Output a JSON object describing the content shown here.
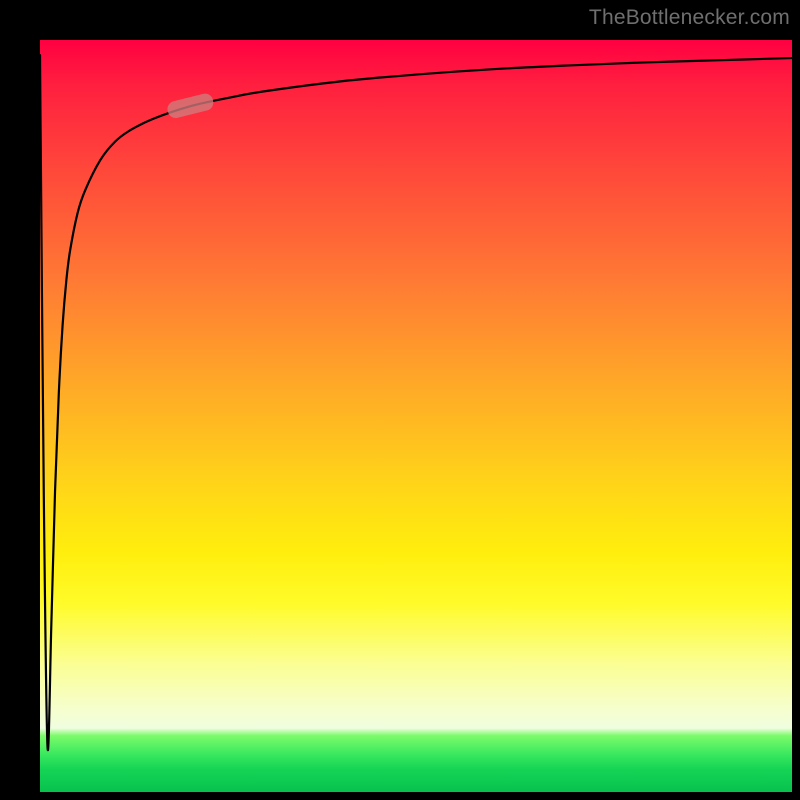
{
  "watermark": "TheBottlenecker.com",
  "chart_data": {
    "type": "line",
    "title": "",
    "xlabel": "",
    "ylabel": "",
    "xlim": [
      0,
      100
    ],
    "ylim": [
      0,
      100
    ],
    "x": [
      0,
      0.5,
      1,
      1.5,
      2,
      2.5,
      3,
      3.5,
      4,
      5,
      6,
      8,
      10,
      12,
      15,
      20,
      25,
      30,
      40,
      50,
      60,
      70,
      80,
      90,
      100
    ],
    "values": [
      98,
      40,
      6,
      22,
      40,
      53,
      62,
      68,
      72,
      77,
      80,
      84,
      86.5,
      88,
      89.5,
      91.2,
      92.3,
      93.2,
      94.5,
      95.4,
      96.1,
      96.6,
      97.0,
      97.3,
      97.6
    ],
    "highlight_segment": {
      "x_start": 17,
      "x_end": 23,
      "y_start": 90.5,
      "y_end": 92.0
    },
    "background_gradient": {
      "orientation": "vertical",
      "stops": [
        {
          "pos": 0.0,
          "color": "#ff0041"
        },
        {
          "pos": 0.3,
          "color": "#ff7a34"
        },
        {
          "pos": 0.6,
          "color": "#ffee0d"
        },
        {
          "pos": 0.9,
          "color": "#f0fee0"
        },
        {
          "pos": 0.95,
          "color": "#39e85f"
        },
        {
          "pos": 1.0,
          "color": "#07c24e"
        }
      ]
    }
  }
}
